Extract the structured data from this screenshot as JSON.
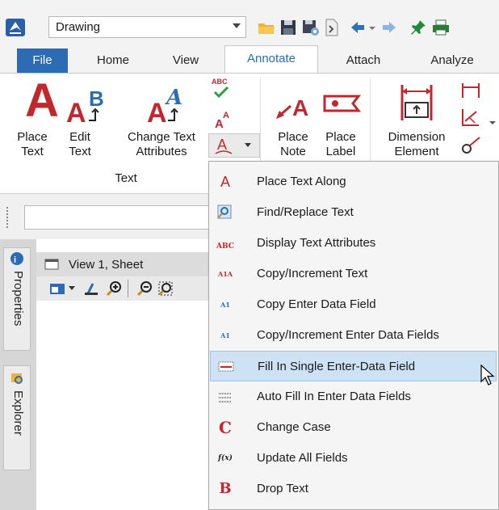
{
  "quick_access": {
    "workflow_value": "Drawing",
    "icons": [
      "app-logo-icon",
      "open-folder-icon",
      "save-icon",
      "save-settings-icon",
      "compress-icon",
      "undo-icon",
      "redo-icon",
      "pin-icon",
      "print-icon"
    ]
  },
  "tabs": [
    {
      "label": "File"
    },
    {
      "label": "Home"
    },
    {
      "label": "View"
    },
    {
      "label": "Annotate"
    },
    {
      "label": "Attach"
    },
    {
      "label": "Analyze"
    }
  ],
  "ribbon": {
    "text_group": {
      "place_text": {
        "line1": "Place",
        "line2": "Text"
      },
      "edit_text": {
        "line1": "Edit",
        "line2": "Text"
      },
      "change_text_attributes": {
        "line1": "Change Text",
        "line2": "Attributes"
      },
      "spell_check_glyph": "ABC",
      "group_label": "Text"
    },
    "notes_group": {
      "place_note": {
        "line1": "Place",
        "line2": "Note"
      },
      "place_label": {
        "line1": "Place",
        "line2": "Label"
      }
    },
    "dimension_group": {
      "dimension_element": {
        "line1": "Dimension",
        "line2": "Element"
      }
    }
  },
  "view_panel": {
    "side_tabs": [
      "Properties",
      "Explorer"
    ],
    "view_title": "View 1, Sheet"
  },
  "menu": {
    "items": [
      {
        "label": "Place Text Along",
        "icon": "place-text-along-icon",
        "glyph": "A"
      },
      {
        "label": "Find/Replace Text",
        "icon": "find-replace-icon",
        "glyph": ""
      },
      {
        "label": "Display Text Attributes",
        "icon": "display-attributes-icon",
        "glyph": "ABC"
      },
      {
        "label": "Copy/Increment Text",
        "icon": "copy-increment-icon",
        "glyph": "A1A"
      },
      {
        "label": "Copy Enter Data Field",
        "icon": "copy-enter-data-icon",
        "glyph": "A1"
      },
      {
        "label": "Copy/Increment Enter Data Fields",
        "icon": "copy-increment-fields-icon",
        "glyph": "A1"
      },
      {
        "label": "Fill In Single Enter-Data Field",
        "icon": "fill-single-field-icon",
        "glyph": ""
      },
      {
        "label": "Auto Fill In Enter Data Fields",
        "icon": "auto-fill-icon",
        "glyph": ""
      },
      {
        "label": "Change Case",
        "icon": "change-case-icon",
        "glyph": "C"
      },
      {
        "label": "Update All Fields",
        "icon": "update-fields-icon",
        "glyph": "f(x)"
      },
      {
        "label": "Drop Text",
        "icon": "drop-text-icon",
        "glyph": "B"
      }
    ],
    "highlighted_index": 6
  },
  "colors": {
    "accent": "#2b6cb5",
    "text_red": "#c4262e",
    "highlight": "#cde2f5"
  }
}
